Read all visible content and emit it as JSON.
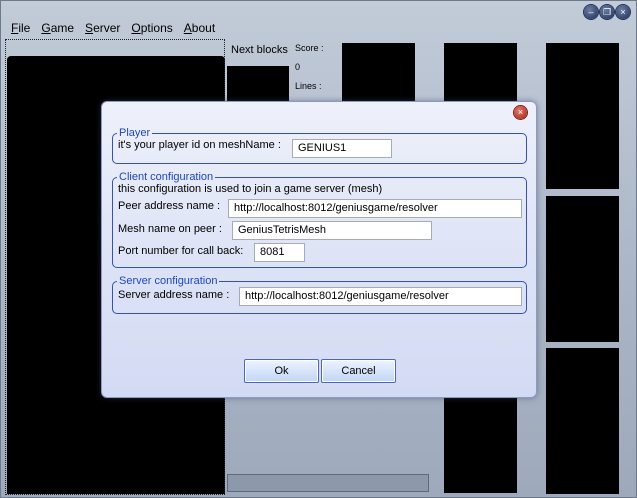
{
  "menu": {
    "items": [
      {
        "underline": "F",
        "rest": "ile"
      },
      {
        "underline": "G",
        "rest": "ame"
      },
      {
        "underline": "S",
        "rest": "erver"
      },
      {
        "underline": "O",
        "rest": "ptions"
      },
      {
        "underline": "A",
        "rest": "bout"
      }
    ]
  },
  "window_controls": {
    "minimize": "–",
    "restore": "❐",
    "close": "×"
  },
  "game": {
    "next_blocks_label": "Next blocks",
    "score_label": "Score :",
    "score_value": "0",
    "lines_label": "Lines :"
  },
  "dialog": {
    "close_glyph": "×",
    "player": {
      "legend": "Player",
      "id_label": "it's your player id on meshName :",
      "id_value": "GENIUS1"
    },
    "client": {
      "legend": "Client configuration",
      "description": "this configuration is used to join a game server (mesh)",
      "peer_label": "Peer address name :",
      "peer_value": "http://localhost:8012/geniusgame/resolver",
      "mesh_label": "Mesh name on peer :",
      "mesh_value": "GeniusTetrisMesh",
      "port_label": "Port number for call back:",
      "port_value": "8081"
    },
    "server": {
      "legend": "Server configuration",
      "address_label": "Server address name :",
      "address_value": "http://localhost:8012/geniusgame/resolver"
    },
    "ok_label": "Ok",
    "cancel_label": "Cancel"
  }
}
